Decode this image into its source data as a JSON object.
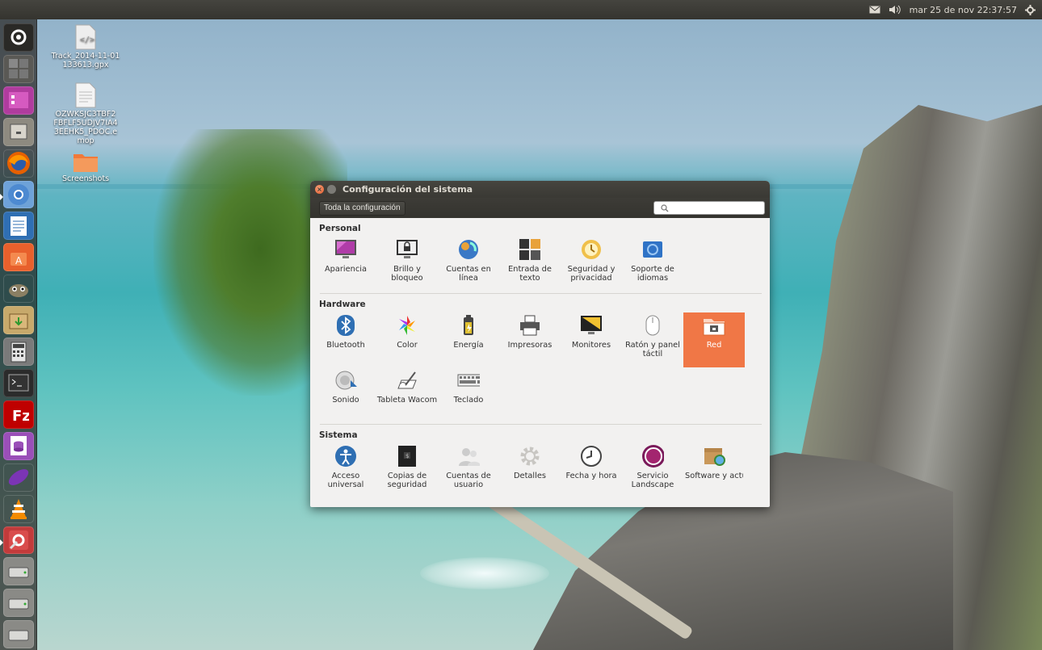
{
  "top_panel": {
    "datetime": "mar 25 de nov 22:37:57"
  },
  "desktop": {
    "icons": [
      {
        "label": "Track_2014-11-01 133613.gpx"
      },
      {
        "label": "OZWKSJC3TBF2FBFLF5UDJV7IA43EEHK5_PDOC.emop"
      },
      {
        "label": "Screenshots"
      }
    ]
  },
  "window": {
    "title": "Configuración del sistema",
    "all_settings_button": "Toda la configuración",
    "search_placeholder": "",
    "sections": [
      {
        "heading": "Personal",
        "items": [
          "Apariencia",
          "Brillo y bloqueo",
          "Cuentas en línea",
          "Entrada de texto",
          "Seguridad y privacidad",
          "Soporte de idiomas"
        ]
      },
      {
        "heading": "Hardware",
        "items": [
          "Bluetooth",
          "Color",
          "Energía",
          "Impresoras",
          "Monitores",
          "Ratón y panel táctil",
          "Red",
          "Sonido",
          "Tableta Wacom",
          "Teclado"
        ]
      },
      {
        "heading": "Sistema",
        "items": [
          "Acceso universal",
          "Copias de seguridad",
          "Cuentas de usuario",
          "Detalles",
          "Fecha y hora",
          "Servicio Landscape",
          "Software y actualizaciones"
        ]
      }
    ],
    "selected_item": "Red"
  },
  "colors": {
    "selection": "#f07746",
    "panel": "#3c3b37",
    "window_bg": "#f2f1f0"
  }
}
